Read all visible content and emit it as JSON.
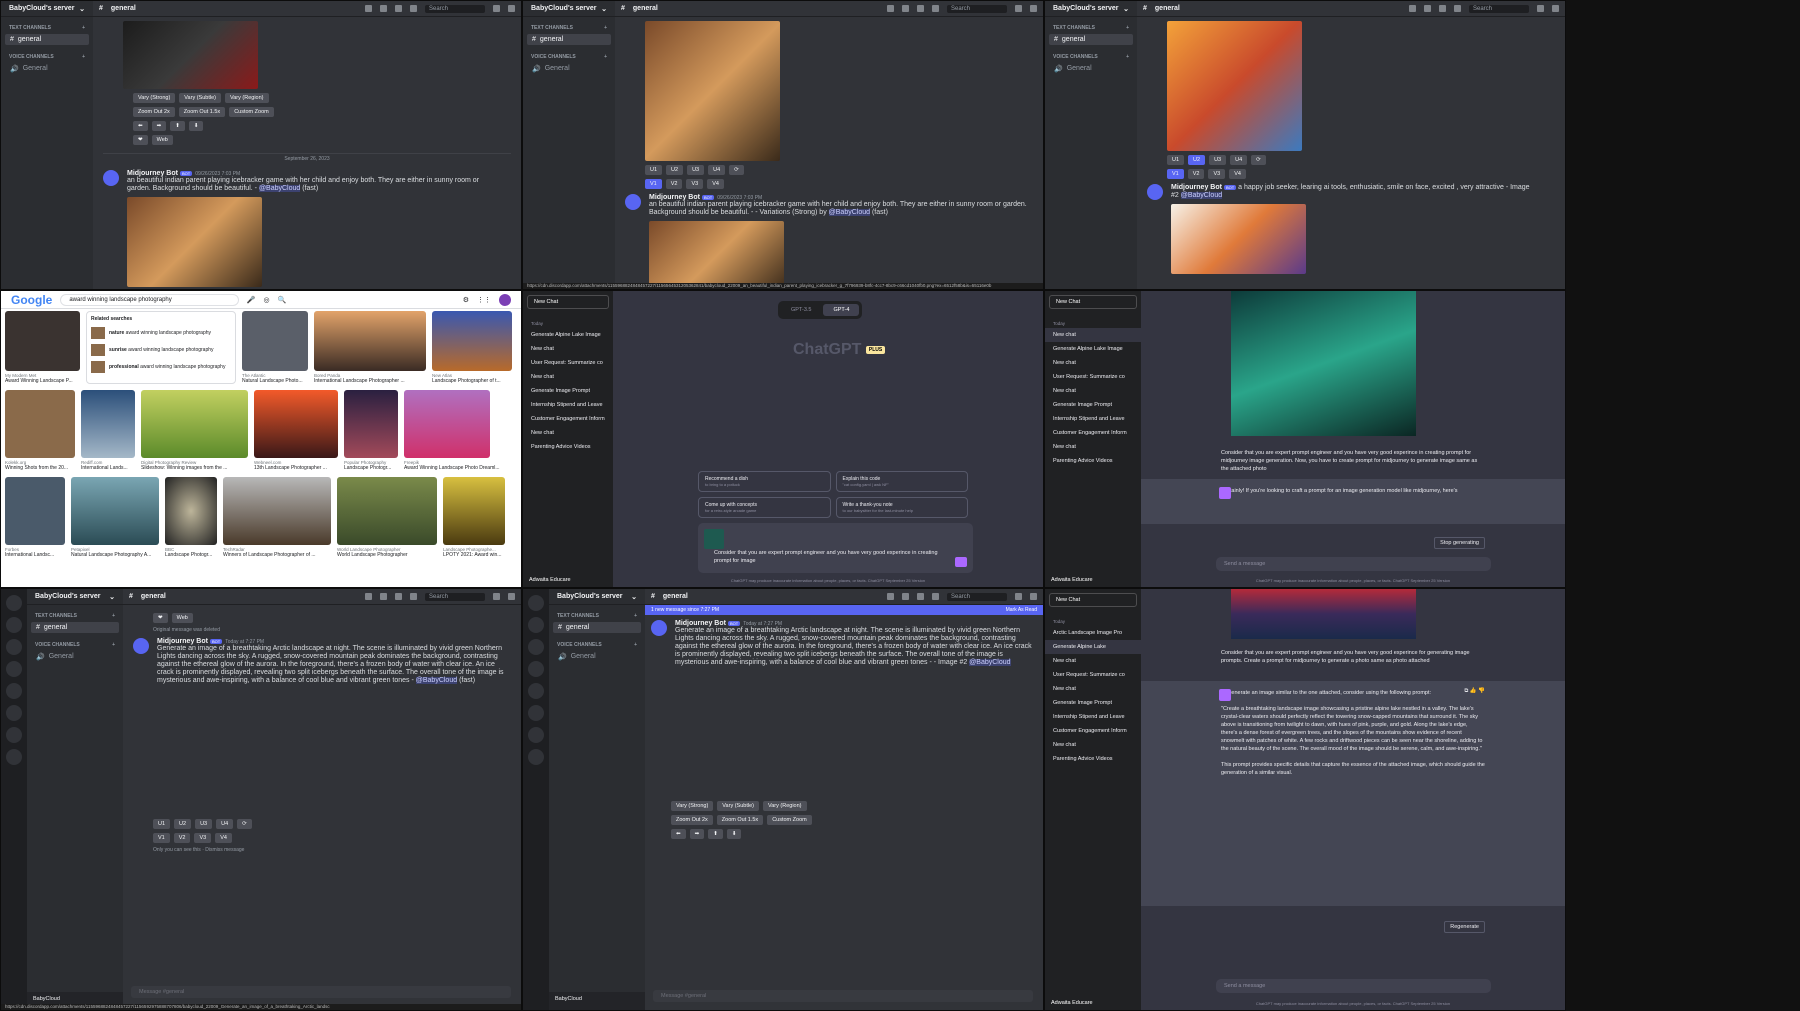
{
  "discord": {
    "server": "BabyCloud's server",
    "channel": "general",
    "search": "Search",
    "cat_text": "TEXT CHANNELS",
    "cat_voice": "VOICE CHANNELS",
    "ch_text": "general",
    "ch_voice": "General",
    "bot": "Midjourney Bot",
    "bot_tag": "BOT",
    "mention": "@BabyCloud",
    "date_sep": "September 26, 2023",
    "time1": "09/26/2023 7:03 PM",
    "prompt_parent": "an beautiful indian parent playing icebracker game with her child and enjoy both. They are either in sunny room or garden. Background should be beautiful. -",
    "fast": "(fast)",
    "variations": "- Variations (Strong) by",
    "prompt_job": "a happy job seeker, learing ai tools, enthusiatic, smile on face, excited , very attractive - Image #2",
    "prompt_arctic": "Generate an image of a breathtaking Arctic landscape at night. The scene is illuminated by vivid green Northern Lights dancing across the sky. A rugged, snow-covered mountain peak dominates the background, contrasting against the ethereal glow of the aurora. In the foreground, there's a frozen body of water with clear ice. An ice crack is prominently displayed, revealing two split icebergs beneath the surface. The overall tone of the image is mysterious and awe-inspiring, with a balance of cool blue and vibrant green tones -",
    "arctic_suffix": "- Image #2",
    "orig_deleted": "Original message was deleted",
    "today_time": "Today at 7:27 PM",
    "new_msgs": "1 new message since 7:27 PM",
    "mark_read": "Mark As Read",
    "btn_vary_strong": "Vary (Strong)",
    "btn_vary_subtle": "Vary (Subtle)",
    "btn_vary_region": "Vary (Region)",
    "btn_zoom2": "Zoom Out 2x",
    "btn_zoom15": "Zoom Out 1.5x",
    "btn_custom": "Custom Zoom",
    "btn_web": "Web",
    "u_btns": [
      "U1",
      "U2",
      "U3",
      "U4"
    ],
    "v_btns": [
      "V1",
      "V2",
      "V3",
      "V4"
    ],
    "input_ph": "Message #general",
    "user": "BabyCloud",
    "only_you": "Only you can see this · Dismiss message"
  },
  "google": {
    "logo": "Google",
    "query": "award winning landscape photography",
    "related_title": "Related searches",
    "related": [
      {
        "b": "nature",
        "t": " award winning landscape photography"
      },
      {
        "b": "sunrise",
        "t": " award winning landscape photography"
      },
      {
        "b": "professional",
        "t": " award winning landscape photography"
      }
    ],
    "row1": [
      {
        "src": "My Modern Met",
        "t": "Award Winning Landscape P..."
      },
      {
        "src": "The Atlantic",
        "t": "Natural Landscape Photo..."
      },
      {
        "src": "Bored Panda",
        "t": "International Landscape Photographer ..."
      },
      {
        "src": "New Atlas",
        "t": "Landscape Photographer of t..."
      }
    ],
    "row2": [
      {
        "src": "Kolekk.org",
        "t": "Winning Shots from the 20..."
      },
      {
        "src": "Rediff.com",
        "t": "International Lands..."
      },
      {
        "src": "Digital Photography Review",
        "t": "Slideshow: Winning images from the ..."
      },
      {
        "src": "Webneel.com",
        "t": "13th Landscape Photographer ..."
      },
      {
        "src": "Popular Photography",
        "t": "Landscape Photogr..."
      },
      {
        "src": "Freepik",
        "t": "Award Winning Landscape Photo Dreaml..."
      }
    ],
    "row3": [
      {
        "src": "Forbes",
        "t": "International Landsc..."
      },
      {
        "src": "Petapixel",
        "t": "Natural Landscape Photography A..."
      },
      {
        "src": "BBC",
        "t": "Landscape Photogr..."
      },
      {
        "src": "TechRadar",
        "t": "Winners of Landscape Photographer of ..."
      },
      {
        "src": "World Landscape Photographer",
        "t": "World Landscape Photographer"
      },
      {
        "src": "Landscape Photographe...",
        "t": "LPOTY 2021: Award win..."
      }
    ]
  },
  "chatgpt": {
    "new_chat": "New Chat",
    "today": "Today",
    "history_a": [
      "Generate Alpine Lake Image",
      "New chat",
      "User Request: Summarize co",
      "New chat",
      "Generate Image Prompt",
      "Internship Stipend and Leave",
      "Customer Engagement Inform",
      "New chat",
      "Parenting Advice Videos"
    ],
    "history_b": [
      "New chat",
      "Generate Alpine Lake Image",
      "New chat",
      "User Request: Summarize co",
      "New chat",
      "Generate Image Prompt",
      "Internship Stipend and Leave",
      "Customer Engagement Inform",
      "New chat",
      "Parenting Advice Videos"
    ],
    "history_c": [
      "Arctic Landscape Image Pro",
      "Generate Alpine Lake",
      "New chat",
      "User Request: Summarize co",
      "New chat",
      "Generate Image Prompt",
      "Internship Stipend and Leave",
      "Customer Engagement Inform",
      "New chat",
      "Parenting Advice Videos"
    ],
    "user": "Adwaita Educare",
    "gpt35": "GPT-3.5",
    "gpt4": "GPT-4",
    "brand": "ChatGPT",
    "plus": "PLUS",
    "suggestions": [
      {
        "t": "Recommend a dish",
        "s": "to bring to a potluck"
      },
      {
        "t": "Explain this code",
        "s": "\"cat config.yaml | awk NF\""
      },
      {
        "t": "Come up with concepts",
        "s": "for a retro-style arcade game"
      },
      {
        "t": "Write a thank-you note",
        "s": "to our babysitter for the last-minute help"
      }
    ],
    "input_text": "Consider that you are expert prompt engineer and you have very good experince in creating prompt for image",
    "disclaimer": "ChatGPT may produce inaccurate information about people, places, or facts. ChatGPT September 25 Version",
    "user_msg": "Consider that you are expert prompt engineer and you have very good experince in creating prompt for midjourney image generation. Now, you have to create prompt for midjourney to generate image same as the attached photo",
    "reply_partial": "Certainly! If you're looking to craft a prompt for an image generation model like midjourney, here's",
    "stop": "Stop generating",
    "send_ph": "Send a message",
    "user_msg2": "Consider that you are expert prompt engineer and you have very good experince for generating image prompts. Create a prompt for midjourney to generate a photo same as photo attached",
    "reply_intro": "To generate an image similar to the one attached, consider using the following prompt:",
    "reply_prompt": "\"Create a breathtaking landscape image showcasing a pristine alpine lake nestled in a valley. The lake's crystal-clear waters should perfectly reflect the towering snow-capped mountains that surround it. The sky above is transitioning from twilight to dawn, with hues of pink, purple, and gold. Along the lake's edge, there's a dense forest of evergreen trees, and the slopes of the mountains show evidence of recent snowmelt with patches of white. A few rocks and driftwood pieces can be seen near the shoreline, adding to the natural beauty of the scene. The overall mood of the image should be serene, calm, and awe-inspiring.\"",
    "reply_outro": "This prompt provides specific details that capture the essence of the attached image, which should guide the generation of a similar visual.",
    "regen": "Regenerate"
  },
  "urls": {
    "u1": "https://cdn.discordapp.com/attachments/1155968824848457227/1156564531205362841/babycloud_22009_an_beautiful_indian_parent_playing_icebracker_g_7f796939-b8fc-4cc7-8bc9-c66cd1040fb0.png?ex=6512f58b&is=65116e0b",
    "u2": "https://cdn.discordapp.com/attachments/1155968824848457227/1156592975888707806/babycloud_22009_Generate_an_image_of_a_breathtaking_Arctic_landsc"
  },
  "colors": {
    "discord_bg": "#313338",
    "blurple": "#5865f2",
    "gpt_bg": "#343541",
    "gpt_accent": "#ab68ff"
  }
}
